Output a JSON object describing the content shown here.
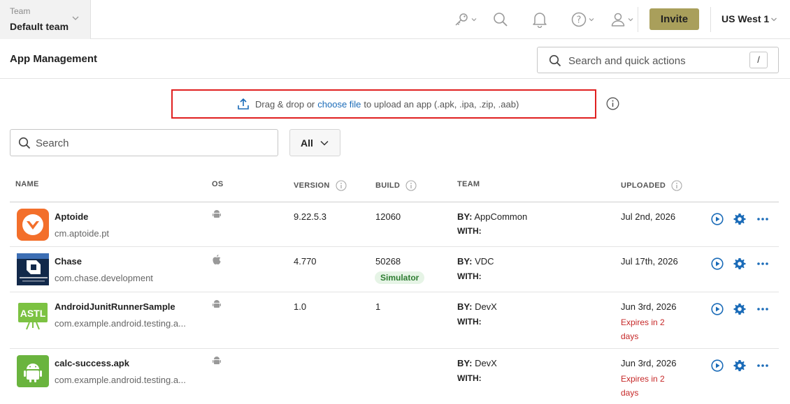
{
  "topbar": {
    "team_caption": "Team",
    "team_name": "Default team",
    "invite_label": "Invite",
    "region": "US West 1",
    "icons": [
      "key-icon",
      "search-icon",
      "bell-icon",
      "help-icon",
      "user-icon"
    ]
  },
  "header": {
    "title": "App Management",
    "search_placeholder": "Search and quick actions",
    "shortcut": "/"
  },
  "upload": {
    "text_before": "Drag & drop or",
    "link_text": "choose file",
    "text_after": "to upload an app (.apk, .ipa, .zip, .aab)"
  },
  "filters": {
    "search_placeholder": "Search",
    "os_value": "All"
  },
  "table": {
    "columns": [
      "NAME",
      "OS",
      "VERSION",
      "BUILD",
      "TEAM",
      "UPLOADED"
    ],
    "by_label": "BY:",
    "with_label": "WITH:",
    "rows": [
      {
        "name": "Aptoide",
        "package": "cm.aptoide.pt",
        "os": "android",
        "version": "9.22.5.3",
        "build": "12060",
        "by": "AppCommon",
        "with": "",
        "uploaded": "Jul 2nd, 2026",
        "badge": "",
        "expires_line1": "",
        "expires_line2": ""
      },
      {
        "name": "Chase",
        "package": "com.chase.development",
        "os": "ios",
        "version": "4.770",
        "build": "50268",
        "by": "VDC",
        "with": "",
        "uploaded": "Jul 17th, 2026",
        "badge": "Simulator",
        "expires_line1": "",
        "expires_line2": ""
      },
      {
        "name": "AndroidJunitRunnerSample",
        "package": "com.example.android.testing.a...",
        "os": "android",
        "version": "1.0",
        "build": "1",
        "by": "DevX",
        "with": "",
        "uploaded": "Jun 3rd, 2026",
        "badge": "",
        "expires_line1": "Expires in 2",
        "expires_line2": "days",
        "icon_text": "ASTL"
      },
      {
        "name": "calc-success.apk",
        "package": "com.example.android.testing.a...",
        "os": "android",
        "version": "",
        "build": "",
        "by": "DevX",
        "with": "",
        "uploaded": "Jun 3rd, 2026",
        "badge": "",
        "expires_line1": "Expires in 2",
        "expires_line2": "days"
      }
    ]
  },
  "colors": {
    "accent_blue": "#1a6bb8",
    "invite_bg": "#a99f5b",
    "upload_border": "#e02020",
    "expires_red": "#c62828",
    "simulator_green": "#2e7d32"
  }
}
